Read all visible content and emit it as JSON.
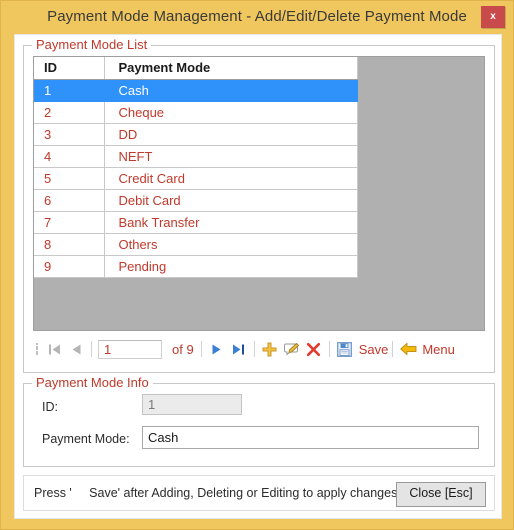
{
  "window": {
    "title": "Payment Mode Management - Add/Edit/Delete Payment Mode",
    "close_label": "x",
    "border_color": "#f0c75e",
    "close_button_color": "#c94a4a"
  },
  "list_panel": {
    "legend": "Payment Mode List",
    "columns": [
      "ID",
      "Payment Mode"
    ],
    "rows": [
      {
        "id": "1",
        "mode": "Cash",
        "selected": true
      },
      {
        "id": "2",
        "mode": "Cheque",
        "selected": false
      },
      {
        "id": "3",
        "mode": "DD",
        "selected": false
      },
      {
        "id": "4",
        "mode": "NEFT",
        "selected": false
      },
      {
        "id": "5",
        "mode": "Credit Card",
        "selected": false
      },
      {
        "id": "6",
        "mode": "Debit Card",
        "selected": false
      },
      {
        "id": "7",
        "mode": "Bank Transfer",
        "selected": false
      },
      {
        "id": "8",
        "mode": "Others",
        "selected": false
      },
      {
        "id": "9",
        "mode": "Pending",
        "selected": false
      }
    ],
    "row_text_color": "#c0392b",
    "selected_row_color": "#2f91fa",
    "empty_area_color": "#b0b0b0"
  },
  "navigator": {
    "first_icon": "first-record-icon",
    "previous_icon": "previous-record-icon",
    "page_value": "1",
    "of_label": "of 9",
    "next_icon": "next-record-icon",
    "last_icon": "last-record-icon",
    "add_icon": "add-icon",
    "edit_icon": "edit-icon",
    "delete_icon": "delete-icon",
    "save_icon": "save-icon",
    "save_label": "Save",
    "menu_icon": "back-arrow-icon",
    "menu_label": "Menu"
  },
  "info_panel": {
    "legend": "Payment Mode Info",
    "id_label": "ID:",
    "id_value": "1",
    "mode_label": "Payment Mode:",
    "mode_value": "Cash"
  },
  "status_bar": {
    "message": "Press '     Save' after Adding, Deleting or Editing to apply changes",
    "close_button": "Close [Esc]"
  }
}
